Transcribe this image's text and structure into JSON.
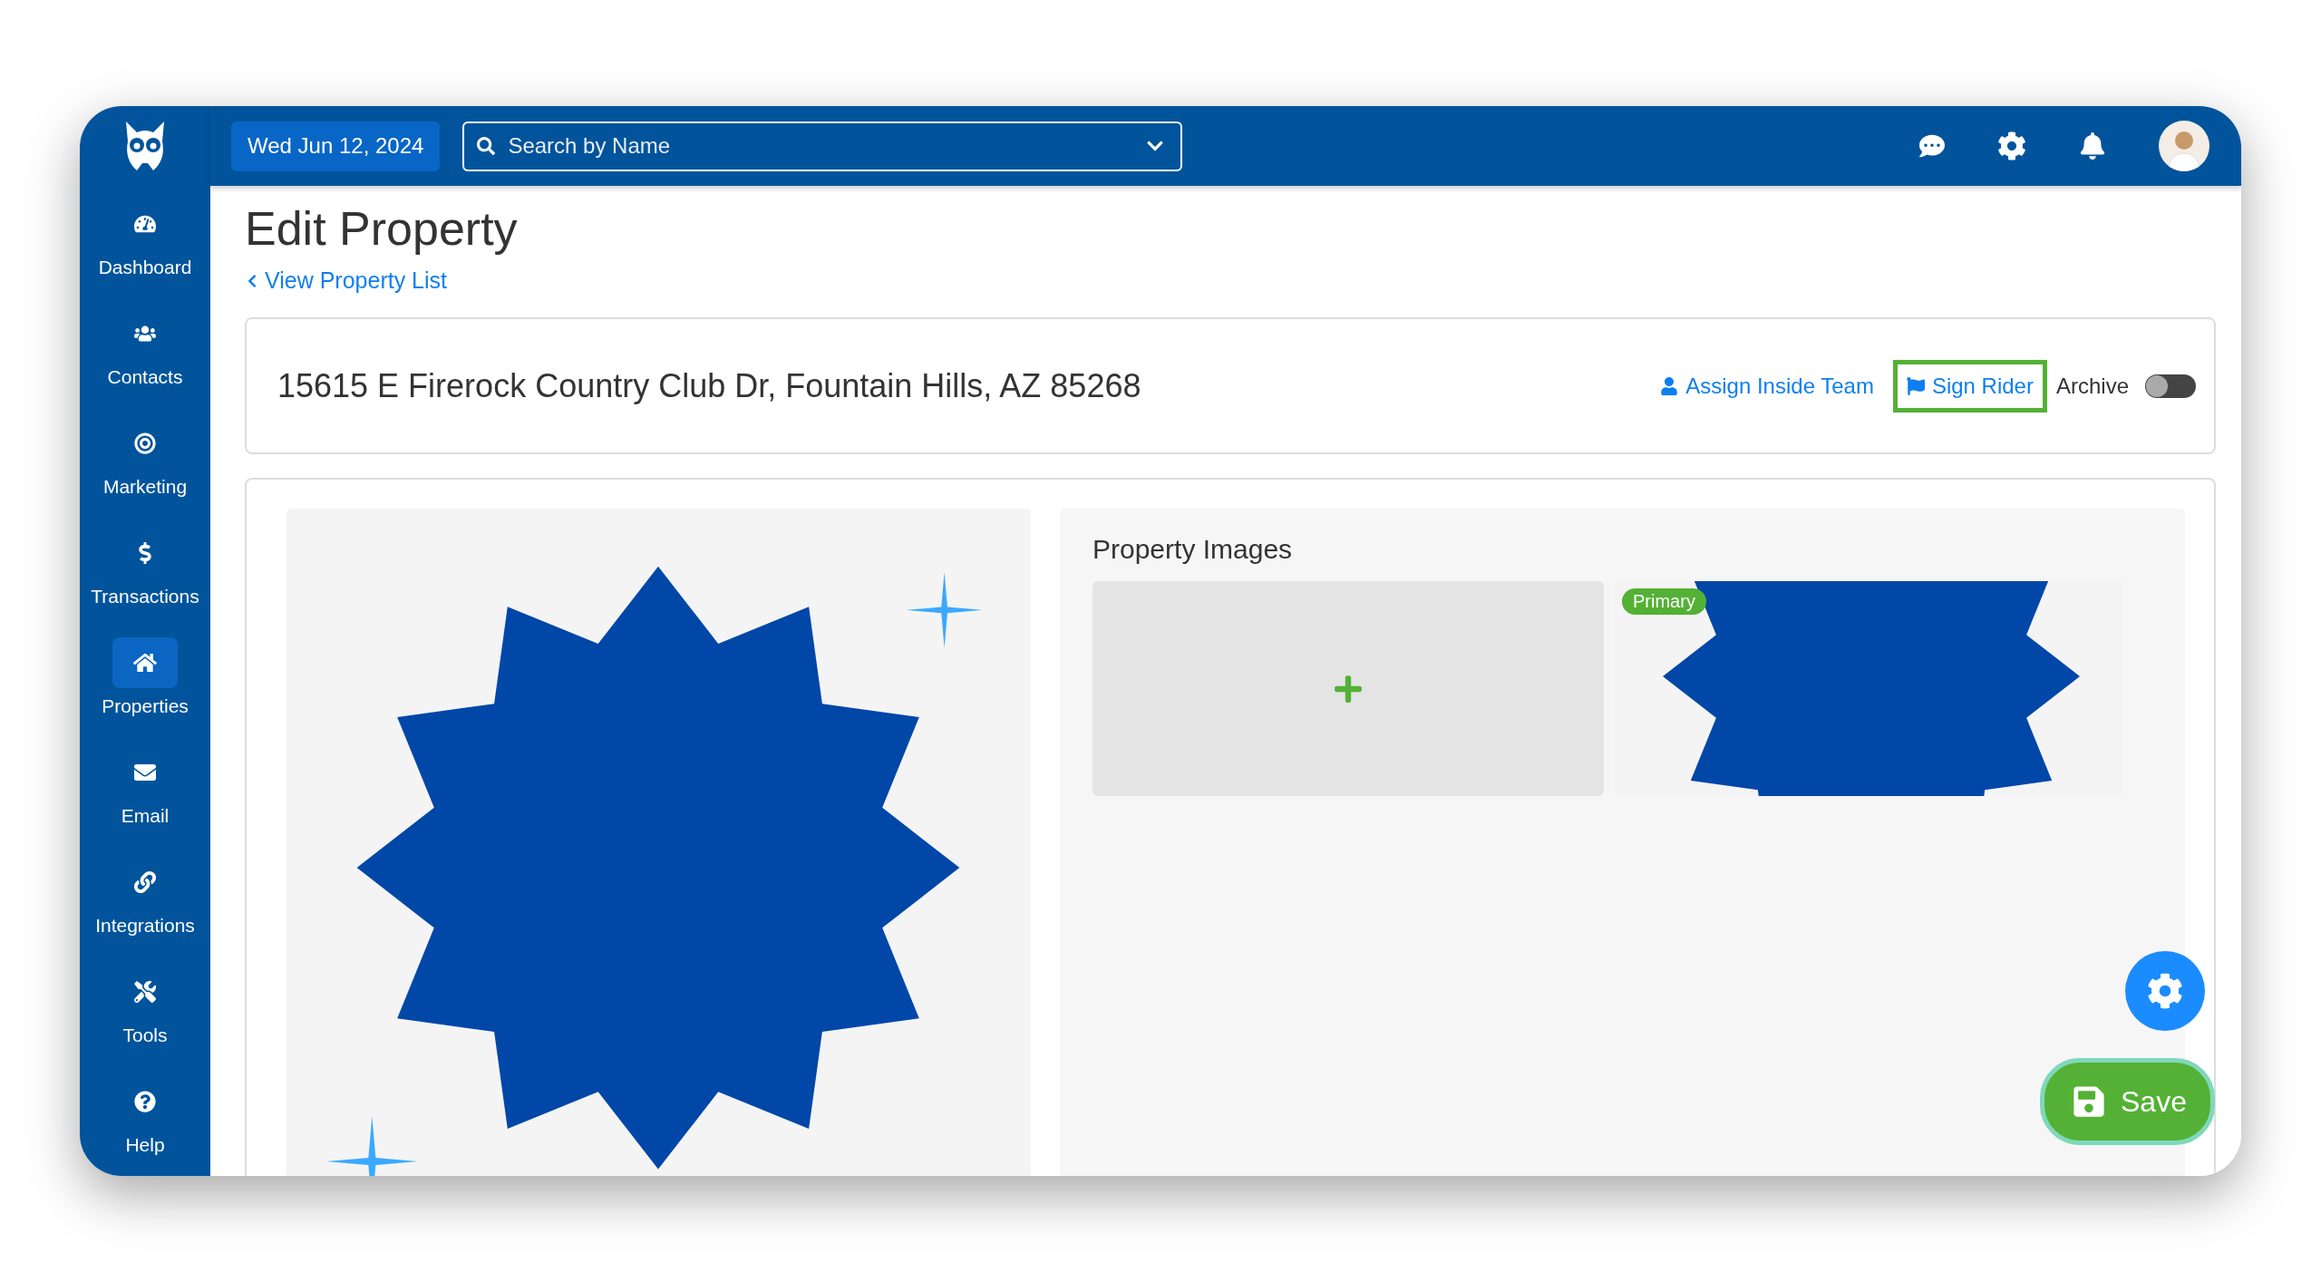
{
  "topbar": {
    "date_button": "Wed Jun 12, 2024",
    "search": {
      "placeholder": "Search by Name"
    }
  },
  "sidebar": {
    "items": [
      {
        "label": "Dashboard",
        "selected": false
      },
      {
        "label": "Contacts",
        "selected": false
      },
      {
        "label": "Marketing",
        "selected": false
      },
      {
        "label": "Transactions",
        "selected": false
      },
      {
        "label": "Properties",
        "selected": true
      },
      {
        "label": "Email",
        "selected": false
      },
      {
        "label": "Integrations",
        "selected": false
      },
      {
        "label": "Tools",
        "selected": false
      },
      {
        "label": "Help",
        "selected": false
      }
    ]
  },
  "page": {
    "title": "Edit Property",
    "back_link": "View Property List"
  },
  "address_card": {
    "address": "15615 E Firerock Country Club Dr, Fountain Hills, AZ 85268",
    "actions": [
      {
        "label": "Assign Inside Team",
        "highlighted": false
      },
      {
        "label": "Sign Rider",
        "highlighted": true
      }
    ],
    "archive": {
      "label": "Archive",
      "on": false
    }
  },
  "images": {
    "title": "Property Images",
    "tiles": [
      {
        "kind": "add"
      },
      {
        "kind": "picture",
        "badge": "Primary"
      }
    ]
  },
  "save_button": "Save"
}
